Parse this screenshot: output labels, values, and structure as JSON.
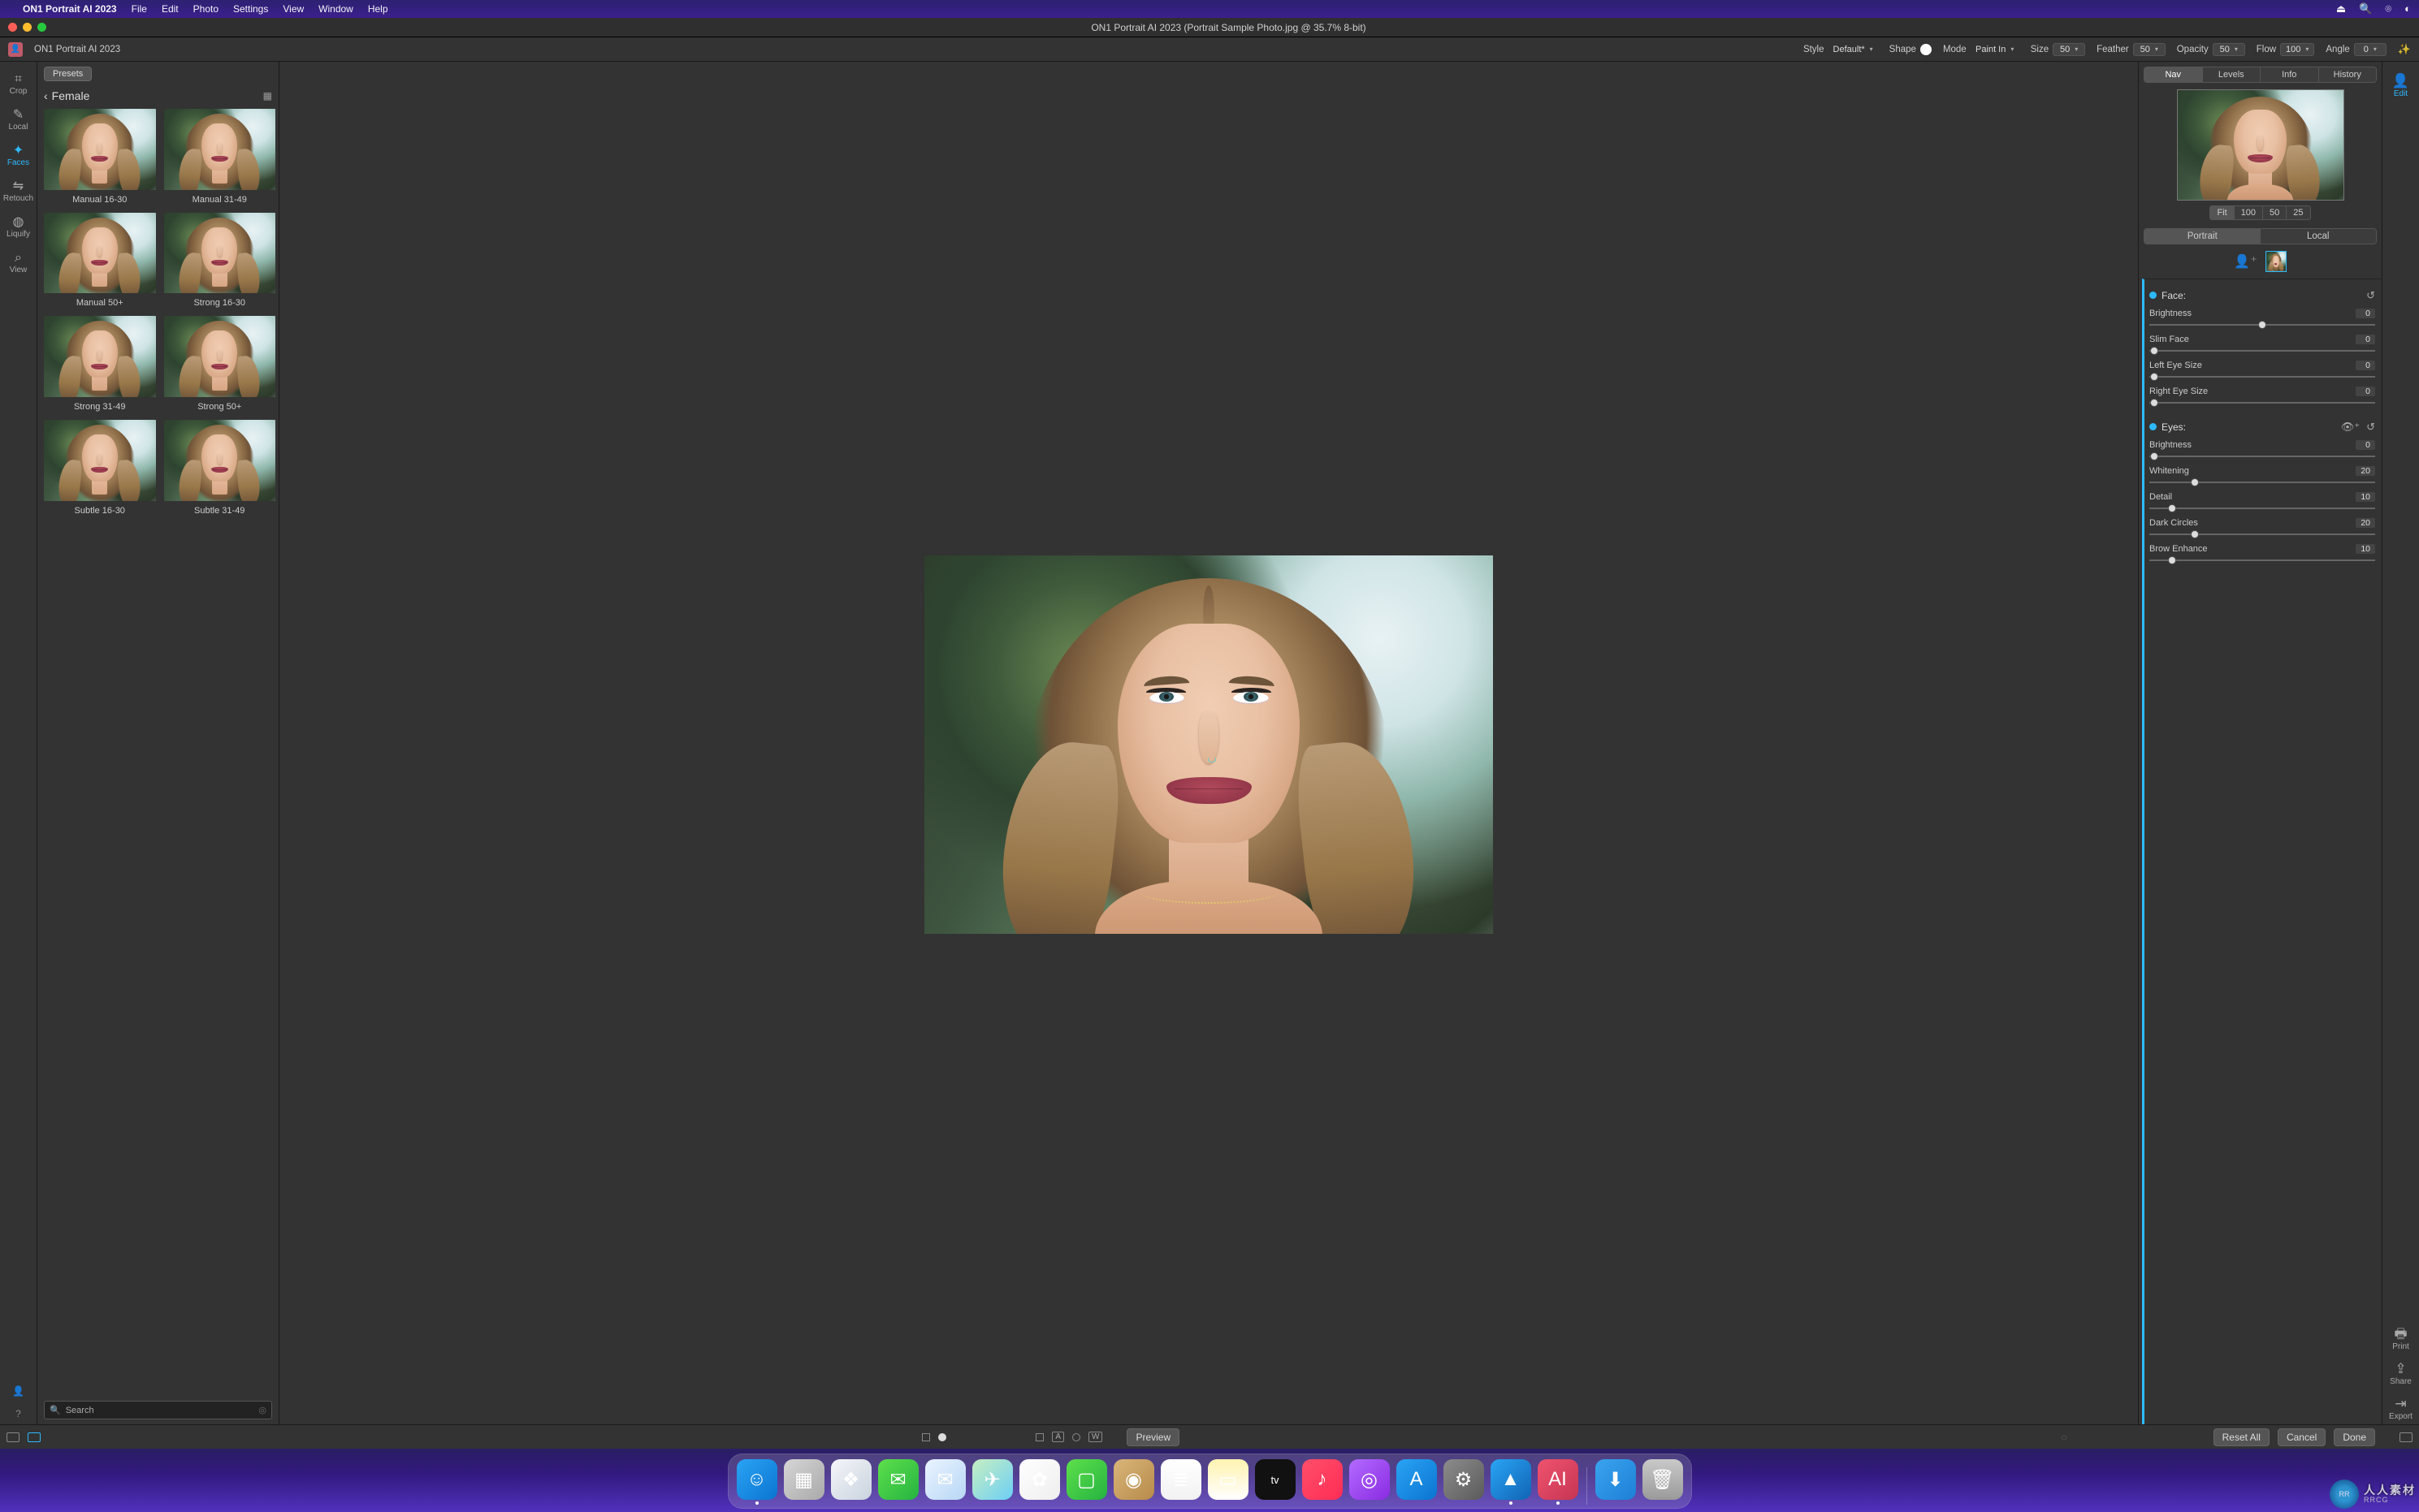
{
  "menubar": {
    "app_title": "ON1 Portrait AI 2023",
    "items": [
      "File",
      "Edit",
      "Photo",
      "Settings",
      "View",
      "Window",
      "Help"
    ]
  },
  "titlebar": {
    "title": "ON1 Portrait AI 2023 (Portrait Sample Photo.jpg @ 35.7% 8-bit)"
  },
  "toolbar": {
    "logo_glyph": "👤",
    "app_label": "ON1 Portrait AI 2023",
    "style_label": "Style",
    "style_value": "Default*",
    "shape_label": "Shape",
    "mode_label": "Mode",
    "mode_value": "Paint In",
    "size_label": "Size",
    "size_value": "50",
    "feather_label": "Feather",
    "feather_value": "50",
    "opacity_label": "Opacity",
    "opacity_value": "50",
    "flow_label": "Flow",
    "flow_value": "100",
    "angle_label": "Angle",
    "angle_value": "0"
  },
  "left_tools": [
    {
      "id": "crop",
      "icon": "⌗",
      "label": "Crop",
      "active": false
    },
    {
      "id": "local",
      "icon": "✎",
      "label": "Local",
      "active": false
    },
    {
      "id": "faces",
      "icon": "✦",
      "label": "Faces",
      "active": true
    },
    {
      "id": "retouch",
      "icon": "⇋",
      "label": "Retouch",
      "active": false
    },
    {
      "id": "liquify",
      "icon": "◍",
      "label": "Liquify",
      "active": false
    },
    {
      "id": "view",
      "icon": "⌕",
      "label": "View",
      "active": false
    }
  ],
  "presets_panel": {
    "tab_label": "Presets",
    "breadcrumb": "Female",
    "search_placeholder": "Search",
    "items": [
      {
        "label": "Manual 16-30"
      },
      {
        "label": "Manual 31-49"
      },
      {
        "label": "Manual 50+"
      },
      {
        "label": "Strong 16-30"
      },
      {
        "label": "Strong 31-49"
      },
      {
        "label": "Strong 50+"
      },
      {
        "label": "Subtle 16-30"
      },
      {
        "label": "Subtle 31-49"
      }
    ]
  },
  "right_rail": {
    "edit": "Edit",
    "print": "Print",
    "share": "Share",
    "export": "Export"
  },
  "right_panel": {
    "tabs": [
      "Nav",
      "Levels",
      "Info",
      "History"
    ],
    "active_tab": "Nav",
    "zoom": [
      "Fit",
      "100",
      "50",
      "25"
    ],
    "zoom_active": "Fit",
    "mode_tabs": [
      "Portrait",
      "Local"
    ],
    "mode_active": "Portrait"
  },
  "sliders": {
    "face_section": "Face:",
    "eyes_section": "Eyes:",
    "face": [
      {
        "name": "Brightness",
        "value": "0",
        "pct": 50
      },
      {
        "name": "Slim Face",
        "value": "0",
        "pct": 2
      },
      {
        "name": "Left Eye Size",
        "value": "0",
        "pct": 2
      },
      {
        "name": "Right Eye Size",
        "value": "0",
        "pct": 2
      }
    ],
    "eyes": [
      {
        "name": "Brightness",
        "value": "0",
        "pct": 2
      },
      {
        "name": "Whitening",
        "value": "20",
        "pct": 20
      },
      {
        "name": "Detail",
        "value": "10",
        "pct": 10
      },
      {
        "name": "Dark Circles",
        "value": "20",
        "pct": 20
      },
      {
        "name": "Brow Enhance",
        "value": "10",
        "pct": 10
      }
    ]
  },
  "statusbar": {
    "preview": "Preview",
    "reset": "Reset All",
    "cancel": "Cancel",
    "done": "Done"
  },
  "dock": [
    {
      "id": "finder",
      "bg": "linear-gradient(135deg,#2aa4f4,#0b74d1)",
      "glyph": "☺",
      "running": true
    },
    {
      "id": "launchpad",
      "bg": "linear-gradient(135deg,#d6d6d6,#a9a9a9)",
      "glyph": "▦"
    },
    {
      "id": "safari",
      "bg": "linear-gradient(135deg,#f5f6fa,#c9d3de)",
      "glyph": "❖"
    },
    {
      "id": "messages",
      "bg": "linear-gradient(135deg,#5ee04b,#25b341)",
      "glyph": "✉"
    },
    {
      "id": "mail",
      "bg": "linear-gradient(135deg,#eaf4ff,#b8d7f5)",
      "glyph": "✉"
    },
    {
      "id": "maps",
      "bg": "linear-gradient(135deg,#c7efc1,#6ccff6)",
      "glyph": "✈"
    },
    {
      "id": "photos",
      "bg": "linear-gradient(135deg,#fff,#eee)",
      "glyph": "✿"
    },
    {
      "id": "facetime",
      "bg": "linear-gradient(135deg,#5ee04b,#25b341)",
      "glyph": "▢"
    },
    {
      "id": "contacts",
      "bg": "linear-gradient(135deg,#d9b67a,#b78a4a)",
      "glyph": "◉"
    },
    {
      "id": "reminders",
      "bg": "linear-gradient(#fff,#f2f2f2)",
      "glyph": "≣"
    },
    {
      "id": "notes",
      "bg": "linear-gradient(#fff3b0,#fff)",
      "glyph": "▭"
    },
    {
      "id": "tv",
      "bg": "#111",
      "glyph": "tv"
    },
    {
      "id": "music",
      "bg": "linear-gradient(135deg,#ff4e6a,#ff2d55)",
      "glyph": "♪"
    },
    {
      "id": "podcasts",
      "bg": "linear-gradient(135deg,#b36bff,#8a2be2)",
      "glyph": "◎"
    },
    {
      "id": "appstore",
      "bg": "linear-gradient(135deg,#2aa4f4,#0b74d1)",
      "glyph": "A"
    },
    {
      "id": "settings",
      "bg": "linear-gradient(135deg,#8c8c8c,#5b5b5b)",
      "glyph": "⚙"
    },
    {
      "id": "on1",
      "bg": "linear-gradient(135deg,#2aa4f4,#1164b5)",
      "glyph": "▲",
      "running": true
    },
    {
      "id": "on1ai",
      "bg": "linear-gradient(135deg,#f0536e,#c53553)",
      "glyph": "AI",
      "running": true
    },
    {
      "id": "sep",
      "sep": true
    },
    {
      "id": "downloads",
      "bg": "linear-gradient(135deg,#3aa4ef,#1d7fd6)",
      "glyph": "⬇"
    },
    {
      "id": "trash",
      "bg": "linear-gradient(#c9c9c9,#9a9a9a)",
      "glyph": "🗑"
    }
  ],
  "watermark": {
    "main": "人人素材",
    "sub": "RRCG"
  }
}
